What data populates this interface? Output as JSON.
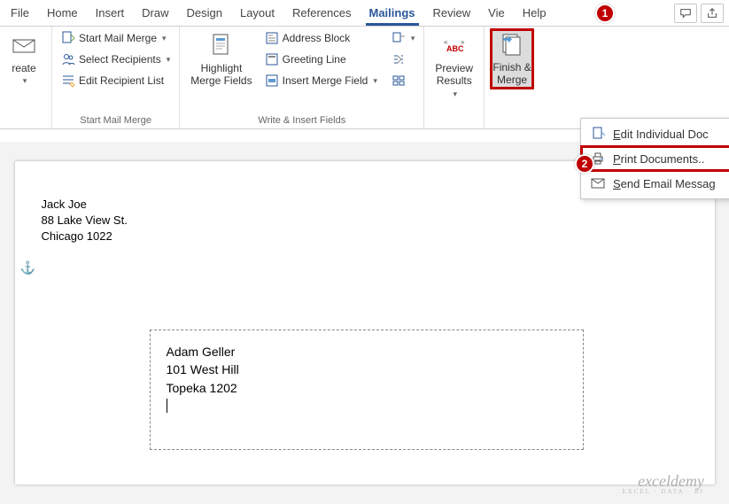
{
  "tabs": {
    "file": "File",
    "home": "Home",
    "insert": "Insert",
    "draw": "Draw",
    "design": "Design",
    "layout": "Layout",
    "references": "References",
    "mailings": "Mailings",
    "review": "Review",
    "view": "Vie",
    "help": "Help"
  },
  "ribbon": {
    "create": "reate",
    "start_mail_merge": "Start Mail Merge",
    "select_recipients": "Select Recipients",
    "edit_recipient_list": "Edit Recipient List",
    "group_start": "Start Mail Merge",
    "highlight_merge_fields": "Highlight\nMerge Fields",
    "address_block": "Address Block",
    "greeting_line": "Greeting Line",
    "insert_merge_field": "Insert Merge Field",
    "group_write": "Write & Insert Fields",
    "preview_results": "Preview\nResults",
    "finish_merge": "Finish &\nMerge"
  },
  "menu": {
    "edit_individual": "Edit Individual Doc",
    "print_documents": "Print Documents..",
    "send_email": "Send Email Messag"
  },
  "callouts": {
    "one": "1",
    "two": "2"
  },
  "document": {
    "return_name": "Jack Joe",
    "return_street": "88 Lake View St.",
    "return_city": "Chicago 1022",
    "recipient_name": "Adam Geller",
    "recipient_street": "101 West Hill",
    "recipient_city": "Topeka 1202"
  },
  "watermark": {
    "brand": "exceldemy",
    "tag": "EXCEL · DATA · BI"
  }
}
